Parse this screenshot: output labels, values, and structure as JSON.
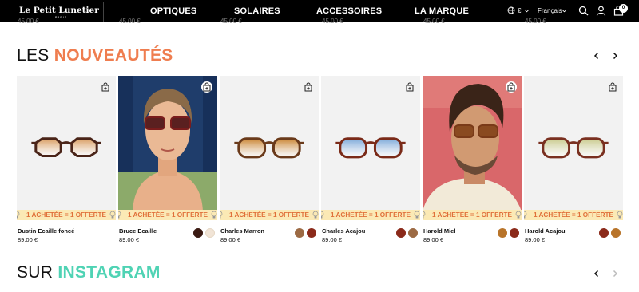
{
  "header": {
    "logo_title": "Le Petit Lunetier",
    "logo_sub": "PARIS",
    "nav": [
      "OPTIQUES",
      "SOLAIRES",
      "ACCESSOIRES",
      "LA MARQUE"
    ],
    "currency": "€",
    "language": "Français",
    "cart_count": "0"
  },
  "top_prices": [
    "45.00 €",
    "45.00 €",
    "45.00 €",
    "45.00 €",
    "45.00 €",
    "45.00 €"
  ],
  "new_section": {
    "title_part1": "LES",
    "title_part2": "NOUVEAUTÉS",
    "accent": "#ef7d4f"
  },
  "promo_text": "1 ACHETÉE = 1 OFFERTE",
  "products": [
    {
      "name": "Dustin Ecaille foncé",
      "price": "89.00 €",
      "swatches": []
    },
    {
      "name": "Bruce Ecaille",
      "price": "89.00 €",
      "swatches": [
        "#3a1a12",
        "#f1e4d6"
      ]
    },
    {
      "name": "Charles Marron",
      "price": "89.00 €",
      "swatches": [
        "#9c6a44",
        "#8b2a1a"
      ]
    },
    {
      "name": "Charles Acajou",
      "price": "89.00 €",
      "swatches": [
        "#8b2a1a",
        "#9c6a44"
      ]
    },
    {
      "name": "Harold Miel",
      "price": "89.00 €",
      "swatches": [
        "#b8742a",
        "#8b2a1a"
      ]
    },
    {
      "name": "Harold Acajou",
      "price": "89.00 €",
      "swatches": [
        "#8b2a1a",
        "#b8742a"
      ]
    }
  ],
  "instagram_section": {
    "title_part1": "SUR",
    "title_part2": "INSTAGRAM",
    "accent": "#4fd3b4"
  }
}
